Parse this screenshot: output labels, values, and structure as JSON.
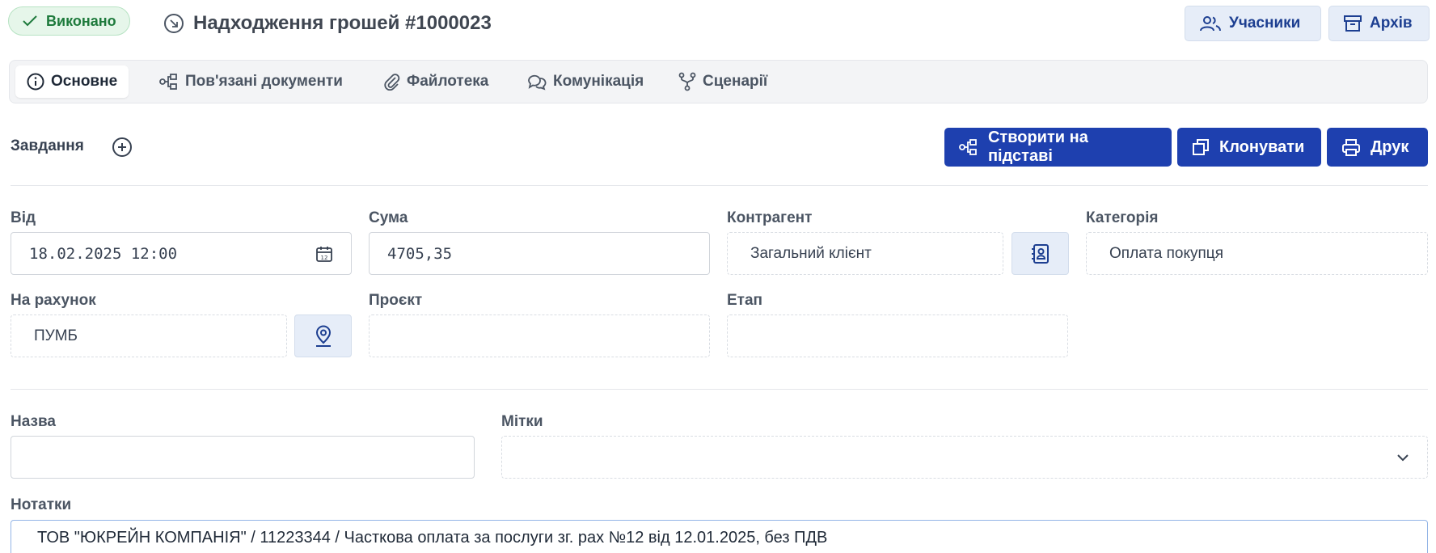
{
  "header": {
    "status_label": "Виконано",
    "title": "Надходження грошей #1000023",
    "participants_label": "Учасники",
    "archive_label": "Архів"
  },
  "tabs": [
    {
      "label": "Основне",
      "icon": "info-icon",
      "active": true
    },
    {
      "label": "Пов'язані документи",
      "icon": "related-docs-icon"
    },
    {
      "label": "Файлотека",
      "icon": "paperclip-icon"
    },
    {
      "label": "Комунікація",
      "icon": "chat-icon"
    },
    {
      "label": "Сценарії",
      "icon": "workflow-icon"
    }
  ],
  "tasks": {
    "label": "Завдання"
  },
  "actions": {
    "create_based_label": "Створити на підставі",
    "clone_label": "Клонувати",
    "print_label": "Друк"
  },
  "form": {
    "from": {
      "label": "Від",
      "value": "18.02.2025 12:00"
    },
    "amount": {
      "label": "Сума",
      "value": "4705,35"
    },
    "counterparty": {
      "label": "Контрагент",
      "value": "Загальний клієнт"
    },
    "category": {
      "label": "Категорія",
      "value": "Оплата покупця"
    },
    "account": {
      "label": "На рахунок",
      "value": "ПУМБ"
    },
    "project": {
      "label": "Проєкт",
      "value": ""
    },
    "stage": {
      "label": "Етап",
      "value": ""
    },
    "name": {
      "label": "Назва",
      "value": ""
    },
    "tags": {
      "label": "Мітки",
      "value": ""
    },
    "notes": {
      "label": "Нотатки",
      "value": "ТОВ \"ЮКРЕЙН КОМПАНІЯ\" /  11223344 /  Часткова оплата за послуги зг. рах №12 від 12.01.2025, без ПДВ"
    }
  },
  "colors": {
    "primary": "#1e40af",
    "status_green": "#1e7a3c",
    "secondary_btn_bg": "#e6edf8"
  }
}
